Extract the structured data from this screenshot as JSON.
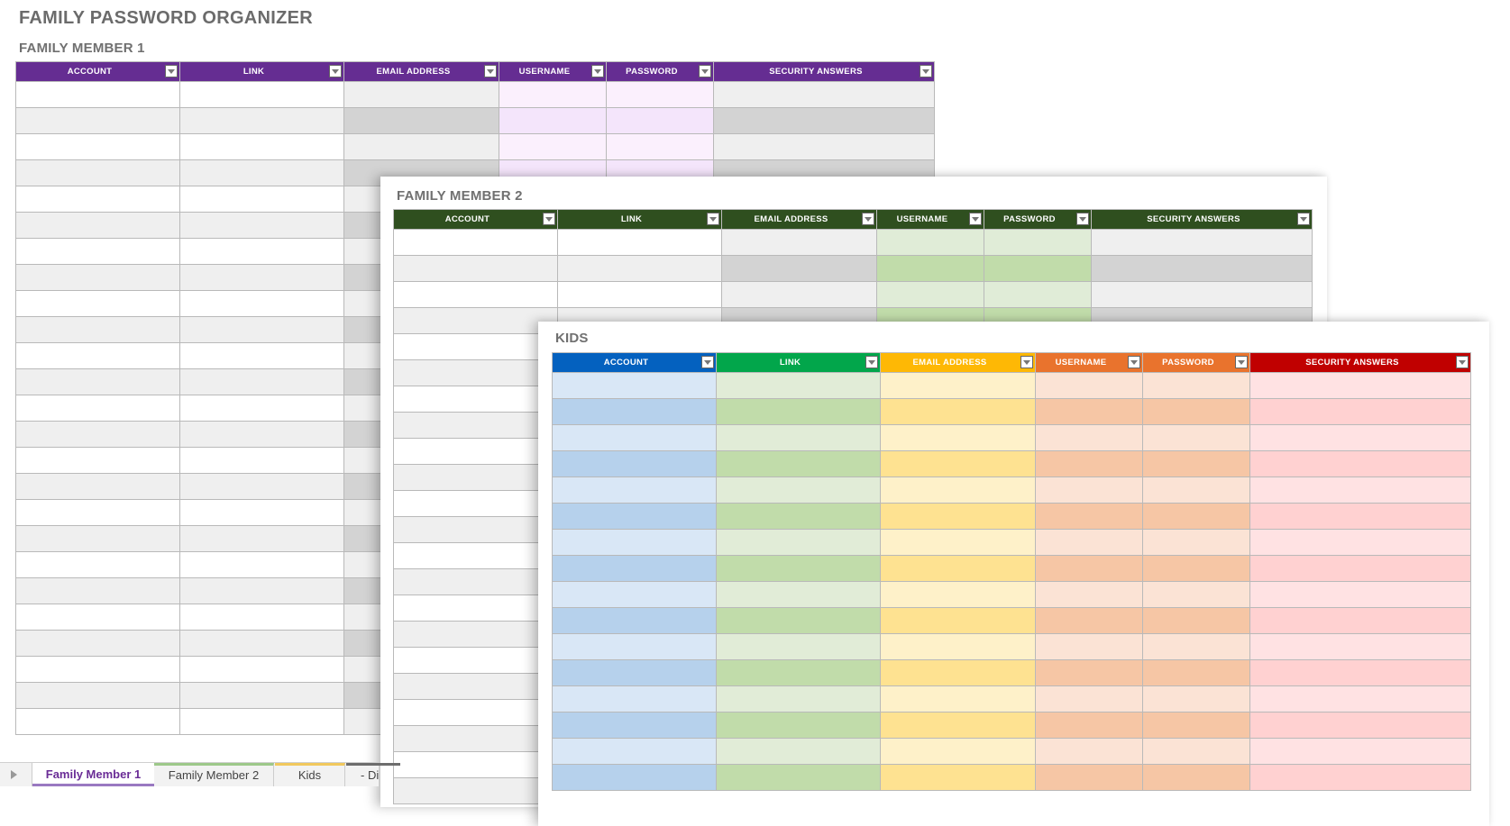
{
  "app_title": "FAMILY PASSWORD ORGANIZER",
  "columns": [
    "ACCOUNT",
    "LINK",
    "EMAIL ADDRESS",
    "USERNAME",
    "PASSWORD",
    "SECURITY ANSWERS"
  ],
  "sections": {
    "fm1": {
      "title": "FAMILY MEMBER 1",
      "header_color": "#652d92",
      "row_count": 25,
      "colors": {
        "odd": [
          "#ffffff",
          "#ffffff",
          "#efefef",
          "#fbf0fd",
          "#fbf0fd",
          "#efefef"
        ],
        "even": [
          "#efefef",
          "#efefef",
          "#d3d3d3",
          "#f4e5fb",
          "#f4e5fb",
          "#d3d3d3"
        ]
      }
    },
    "fm2": {
      "title": "FAMILY MEMBER 2",
      "header_color": "#2f4f1f",
      "row_count": 22,
      "colors": {
        "odd": [
          "#ffffff",
          "#ffffff",
          "#efefef",
          "#e0ecd7",
          "#e0ecd7",
          "#efefef"
        ],
        "even": [
          "#efefef",
          "#efefef",
          "#d3d3d3",
          "#c1dcaa",
          "#c1dcaa",
          "#d3d3d3"
        ]
      }
    },
    "kids": {
      "title": "KIDS",
      "header_colors": [
        "#0461bf",
        "#02a64b",
        "#feb805",
        "#e9732d",
        "#e9732d",
        "#c00000"
      ],
      "row_count": 16,
      "colors": {
        "odd": [
          "#d9e7f6",
          "#e1ecd7",
          "#fef1c9",
          "#fbe3d5",
          "#fbe3d5",
          "#ffe2e3"
        ],
        "even": [
          "#b6d1ec",
          "#c1dcaa",
          "#fee291",
          "#f6c6a5",
          "#f6c6a5",
          "#ffd1d1"
        ]
      }
    }
  },
  "sheet_tabs": [
    {
      "label": "Family Member 1",
      "active": true,
      "accent": "#9a79c1"
    },
    {
      "label": "Family Member 2",
      "active": false,
      "accent": "#9dc88a"
    },
    {
      "label": "Kids",
      "active": false,
      "accent": "#f1c85d"
    },
    {
      "label": "- Di",
      "active": false,
      "accent": "#6d6d6d"
    }
  ]
}
